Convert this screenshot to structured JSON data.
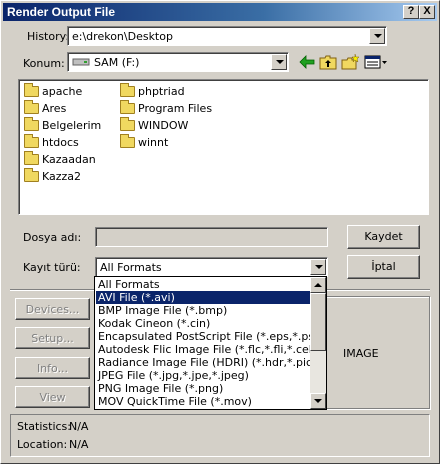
{
  "window": {
    "title": "Render Output File",
    "help_label": "?",
    "close_label": "X"
  },
  "history": {
    "label": "History:",
    "value": "e:\\drekon\\Desktop"
  },
  "location": {
    "label": "Konum:",
    "value": "SAM (F:)"
  },
  "toolbar": {
    "icons": [
      "back-icon",
      "up-folder-icon",
      "new-folder-icon",
      "view-menu-icon"
    ]
  },
  "files": {
    "column1": [
      "apache",
      "Ares",
      "Belgelerim",
      "htdocs",
      "Kazaadan",
      "Kazza2"
    ],
    "column2": [
      "phptriad",
      "Program Files",
      "WINDOW",
      "winnt"
    ]
  },
  "filename": {
    "label": "Dosya adı:",
    "value": ""
  },
  "filetype": {
    "label": "Kayıt türü:",
    "value": "All Formats"
  },
  "buttons": {
    "save": "Kaydet",
    "cancel": "İptal",
    "devices": "Devices...",
    "setup": "Setup...",
    "info": "Info...",
    "view": "View"
  },
  "preview": {
    "text": "IMAGE"
  },
  "dropdown": {
    "items": [
      "All Formats",
      "AVI File (*.avi)",
      "BMP Image File (*.bmp)",
      "Kodak Cineon (*.cin)",
      "Encapsulated PostScript File (*.eps,*.ps)",
      "Autodesk Flic Image File (*.flc,*.fli,*.cel)",
      "Radiance Image File (HDRI) (*.hdr,*.pic)",
      "JPEG File (*.jpg,*.jpe,*.jpeg)",
      "PNG Image File (*.png)",
      "MOV QuickTime File (*.mov)"
    ],
    "selected_index": 1
  },
  "status": {
    "statistics_label": "Statistics:",
    "statistics_value": "N/A",
    "location_label": "Location:",
    "location_value": "N/A"
  },
  "colors": {
    "titlebar_start": "#0a246a",
    "titlebar_end": "#a6caf0",
    "selection": "#0a246a",
    "face": "#d4d0c8",
    "folder": "#f0d860"
  }
}
